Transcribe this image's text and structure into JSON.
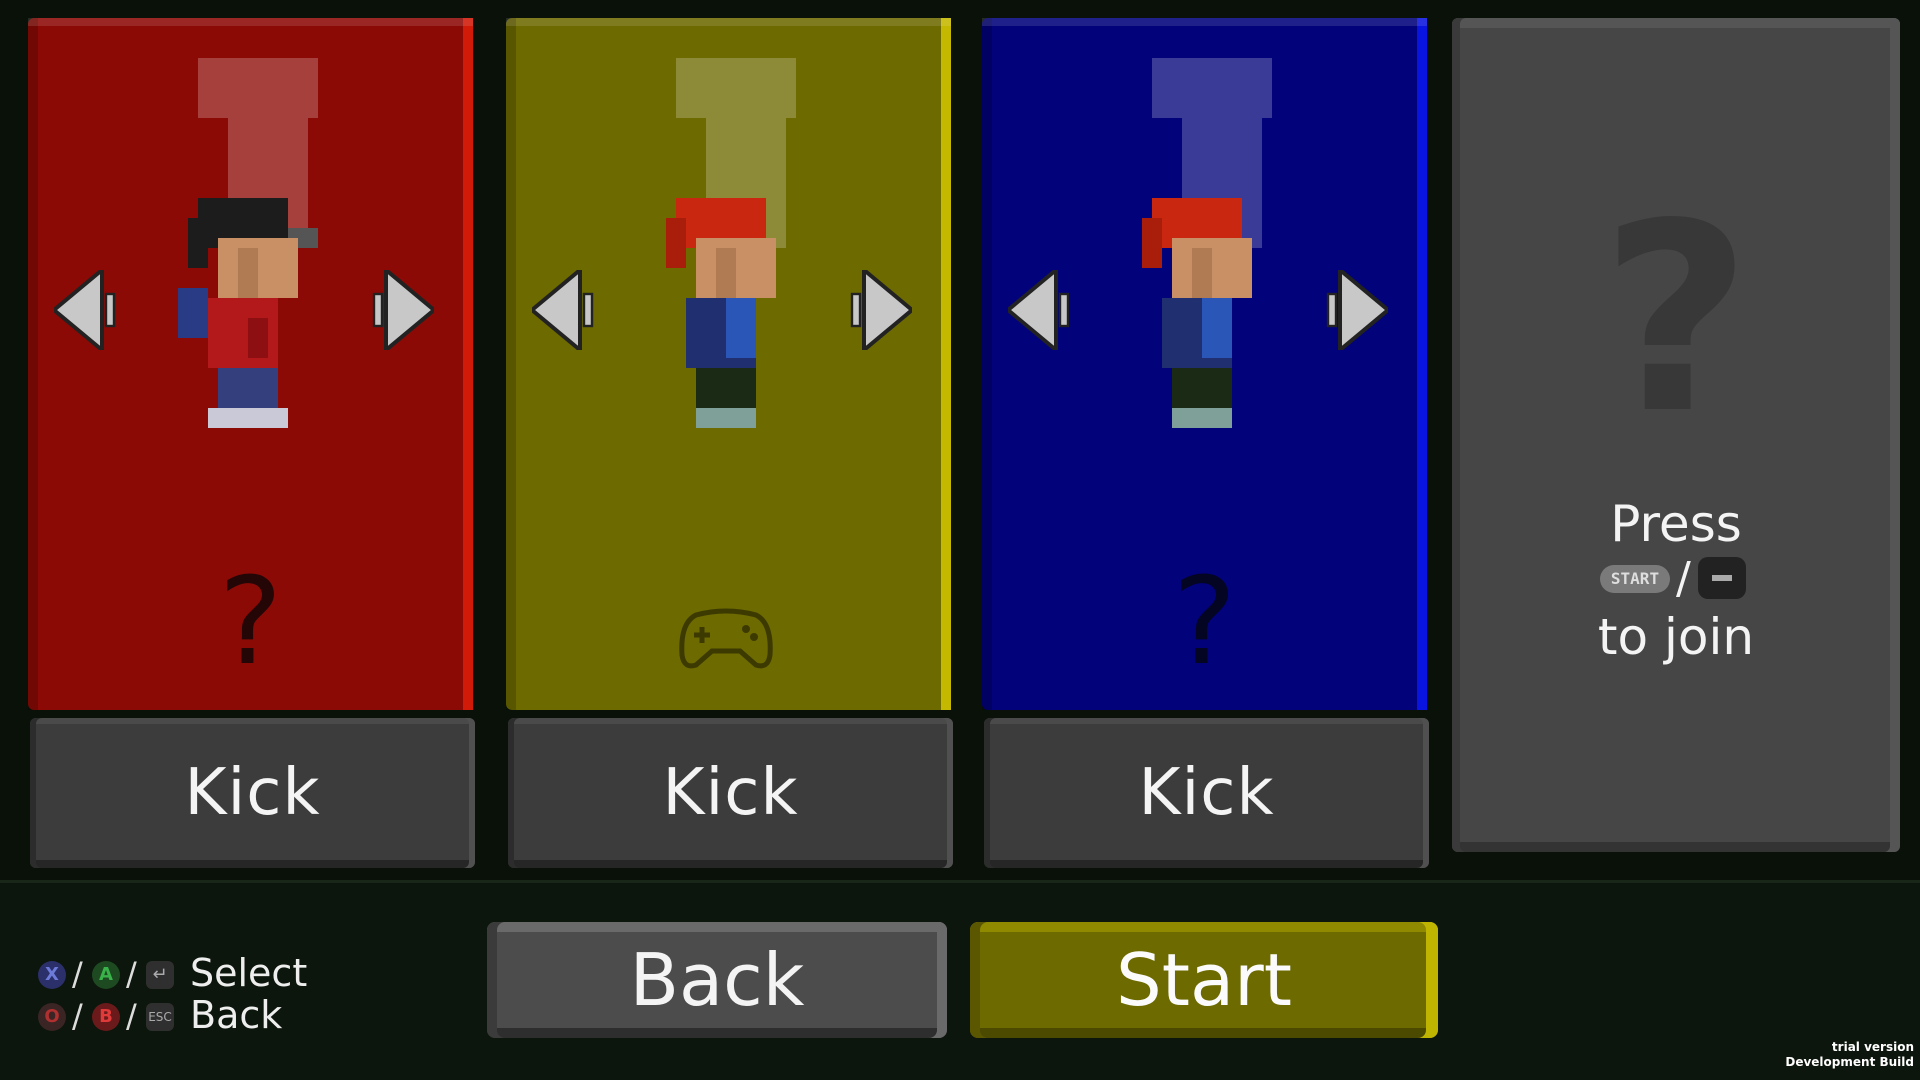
{
  "players": [
    {
      "id": "p1",
      "color": "#8c0a06",
      "border_color": "#d11a08",
      "status_icon": "question-mark-icon",
      "status_text": "?",
      "kick_label": "Kick",
      "character": "dark-haired-kid-red-jacket"
    },
    {
      "id": "p2",
      "color": "#6d6a00",
      "border_color": "#c5b800",
      "status_icon": "gamepad-icon",
      "status_text": "",
      "kick_label": "Kick",
      "character": "red-haired-kid-blue-jacket"
    },
    {
      "id": "p3",
      "color": "#02027a",
      "border_color": "#0a14e0",
      "status_icon": "question-mark-icon",
      "status_text": "?",
      "kick_label": "Kick",
      "character": "red-haired-kid-blue-jacket"
    }
  ],
  "empty_slot": {
    "placeholder": "?",
    "press_label": "Press",
    "start_key": "START",
    "separator": "/",
    "minus_key": "−",
    "join_label": "to join"
  },
  "legend": {
    "select": {
      "buttons": [
        "X",
        "A",
        "↵"
      ],
      "label": "Select"
    },
    "back": {
      "buttons": [
        "O",
        "B",
        "ESC"
      ],
      "label": "Back"
    }
  },
  "buttons": {
    "back_label": "Back",
    "start_label": "Start"
  },
  "build": {
    "line1": "trial version",
    "line2": "Development Build"
  }
}
